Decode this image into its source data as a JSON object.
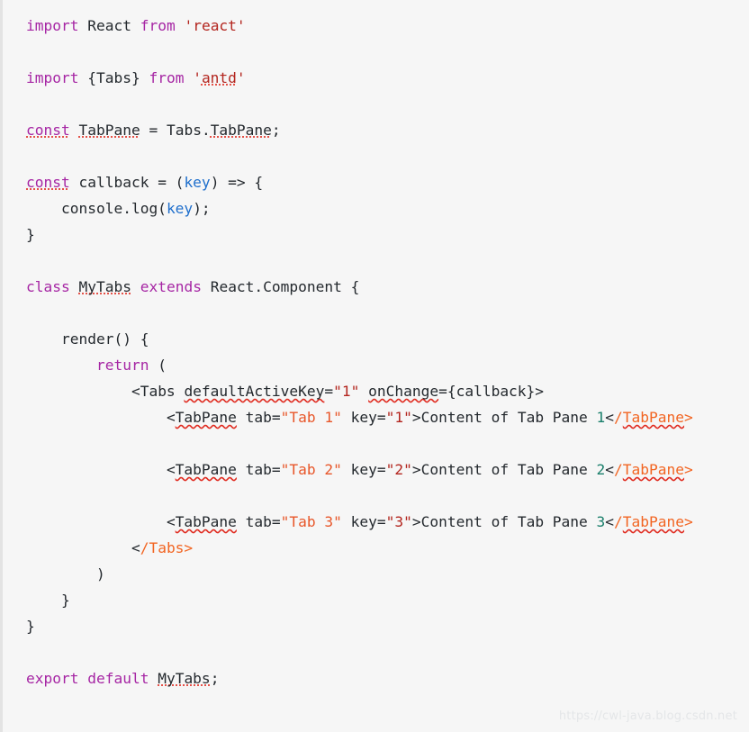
{
  "editor": {
    "background_color": "#f6f6f6",
    "gutter_border_color": "#e3e3e3",
    "default_text_color": "#24292e",
    "language": "jsx",
    "colors": {
      "keyword": "#a626a4",
      "string": "#b3251e",
      "string_attr": "#e8572a",
      "parameter": "#1f6fcc",
      "closing_tag": "#f26522",
      "number": "#1a7f6b",
      "error_underline": "#e02b20"
    }
  },
  "code": {
    "lines": [
      {
        "id": "line-import-react",
        "tokens": [
          {
            "t": "import",
            "c": "tok-kw"
          },
          {
            "t": " React ",
            "c": "tok-plain"
          },
          {
            "t": "from",
            "c": "tok-kw"
          },
          {
            "t": " ",
            "c": "tok-plain"
          },
          {
            "t": "'react'",
            "c": "tok-str"
          }
        ]
      },
      {
        "id": "line-blank-1",
        "blank": true,
        "tokens": []
      },
      {
        "id": "line-import-antd",
        "tokens": [
          {
            "t": "import",
            "c": "tok-kw"
          },
          {
            "t": " {Tabs} ",
            "c": "tok-plain"
          },
          {
            "t": "from",
            "c": "tok-kw"
          },
          {
            "t": " ",
            "c": "tok-plain"
          },
          {
            "t": "'",
            "c": "tok-str"
          },
          {
            "t": "antd",
            "c": "tok-str",
            "u": "dot"
          },
          {
            "t": "'",
            "c": "tok-str"
          }
        ]
      },
      {
        "id": "line-blank-2",
        "blank": true,
        "tokens": []
      },
      {
        "id": "line-const-tabpane",
        "tokens": [
          {
            "t": "const",
            "c": "tok-kw",
            "u": "dot"
          },
          {
            "t": " ",
            "c": "tok-plain"
          },
          {
            "t": "TabPane",
            "c": "tok-plain",
            "u": "dot"
          },
          {
            "t": " = Tabs.",
            "c": "tok-plain"
          },
          {
            "t": "TabPane",
            "c": "tok-plain",
            "u": "dot"
          },
          {
            "t": ";",
            "c": "tok-plain"
          }
        ]
      },
      {
        "id": "line-blank-3",
        "blank": true,
        "tokens": []
      },
      {
        "id": "line-const-callback",
        "tokens": [
          {
            "t": "const",
            "c": "tok-kw",
            "u": "dot"
          },
          {
            "t": " callback = (",
            "c": "tok-plain"
          },
          {
            "t": "key",
            "c": "tok-param"
          },
          {
            "t": ") => {",
            "c": "tok-plain"
          }
        ]
      },
      {
        "id": "line-console-log",
        "tokens": [
          {
            "t": "    console.log(",
            "c": "tok-plain"
          },
          {
            "t": "key",
            "c": "tok-param"
          },
          {
            "t": ");",
            "c": "tok-plain"
          }
        ]
      },
      {
        "id": "line-close-callback",
        "tokens": [
          {
            "t": "}",
            "c": "tok-plain"
          }
        ]
      },
      {
        "id": "line-blank-4",
        "blank": true,
        "tokens": []
      },
      {
        "id": "line-class-mytabs",
        "tokens": [
          {
            "t": "class",
            "c": "tok-kw"
          },
          {
            "t": " ",
            "c": "tok-plain"
          },
          {
            "t": "MyTabs",
            "c": "tok-plain",
            "u": "dot"
          },
          {
            "t": " ",
            "c": "tok-plain"
          },
          {
            "t": "extends",
            "c": "tok-kw"
          },
          {
            "t": " React.Component {",
            "c": "tok-plain"
          }
        ]
      },
      {
        "id": "line-blank-5",
        "blank": true,
        "tokens": []
      },
      {
        "id": "line-render",
        "tokens": [
          {
            "t": "    render() {",
            "c": "tok-plain"
          }
        ]
      },
      {
        "id": "line-return",
        "tokens": [
          {
            "t": "        ",
            "c": "tok-plain"
          },
          {
            "t": "return",
            "c": "tok-kw"
          },
          {
            "t": " (",
            "c": "tok-plain"
          }
        ]
      },
      {
        "id": "line-tabs-open",
        "tokens": [
          {
            "t": "            <Tabs ",
            "c": "tok-plain"
          },
          {
            "t": "defaultActiveKey",
            "c": "tok-plain",
            "u": "wavy"
          },
          {
            "t": "=",
            "c": "tok-plain"
          },
          {
            "t": "\"1\"",
            "c": "tok-str"
          },
          {
            "t": " ",
            "c": "tok-plain"
          },
          {
            "t": "onChange",
            "c": "tok-plain",
            "u": "wavy"
          },
          {
            "t": "={callback}>",
            "c": "tok-plain"
          }
        ]
      },
      {
        "id": "line-tabpane-1",
        "tokens": [
          {
            "t": "                <",
            "c": "tok-plain"
          },
          {
            "t": "TabPane",
            "c": "tok-plain",
            "u": "wavy"
          },
          {
            "t": " tab=",
            "c": "tok-plain"
          },
          {
            "t": "\"Tab 1\"",
            "c": "tok-str2"
          },
          {
            "t": " key=",
            "c": "tok-plain"
          },
          {
            "t": "\"1\"",
            "c": "tok-str"
          },
          {
            "t": ">Content of Tab Pane ",
            "c": "tok-plain"
          },
          {
            "t": "1",
            "c": "tok-num"
          },
          {
            "t": "<",
            "c": "tok-plain"
          },
          {
            "t": "/",
            "c": "tok-tagclose"
          },
          {
            "t": "TabPane",
            "c": "tok-tagclose",
            "u": "wavy"
          },
          {
            "t": ">",
            "c": "tok-tagclose"
          }
        ]
      },
      {
        "id": "line-blank-6",
        "blank": true,
        "tokens": []
      },
      {
        "id": "line-tabpane-2",
        "tokens": [
          {
            "t": "                <",
            "c": "tok-plain"
          },
          {
            "t": "TabPane",
            "c": "tok-plain",
            "u": "wavy"
          },
          {
            "t": " tab=",
            "c": "tok-plain"
          },
          {
            "t": "\"Tab 2\"",
            "c": "tok-str2"
          },
          {
            "t": " key=",
            "c": "tok-plain"
          },
          {
            "t": "\"2\"",
            "c": "tok-str"
          },
          {
            "t": ">Content of Tab Pane ",
            "c": "tok-plain"
          },
          {
            "t": "2",
            "c": "tok-num"
          },
          {
            "t": "<",
            "c": "tok-plain"
          },
          {
            "t": "/",
            "c": "tok-tagclose"
          },
          {
            "t": "TabPane",
            "c": "tok-tagclose",
            "u": "wavy"
          },
          {
            "t": ">",
            "c": "tok-tagclose"
          }
        ]
      },
      {
        "id": "line-blank-7",
        "blank": true,
        "tokens": []
      },
      {
        "id": "line-tabpane-3",
        "tokens": [
          {
            "t": "                <",
            "c": "tok-plain"
          },
          {
            "t": "TabPane",
            "c": "tok-plain",
            "u": "wavy"
          },
          {
            "t": " tab=",
            "c": "tok-plain"
          },
          {
            "t": "\"Tab 3\"",
            "c": "tok-str2"
          },
          {
            "t": " key=",
            "c": "tok-plain"
          },
          {
            "t": "\"3\"",
            "c": "tok-str"
          },
          {
            "t": ">Content of Tab Pane ",
            "c": "tok-plain"
          },
          {
            "t": "3",
            "c": "tok-num"
          },
          {
            "t": "<",
            "c": "tok-plain"
          },
          {
            "t": "/",
            "c": "tok-tagclose"
          },
          {
            "t": "TabPane",
            "c": "tok-tagclose",
            "u": "wavy"
          },
          {
            "t": ">",
            "c": "tok-tagclose"
          }
        ]
      },
      {
        "id": "line-tabs-close",
        "tokens": [
          {
            "t": "            ",
            "c": "tok-plain"
          },
          {
            "t": "<",
            "c": "tok-plain"
          },
          {
            "t": "/Tabs>",
            "c": "tok-tagclose"
          }
        ]
      },
      {
        "id": "line-close-paren",
        "tokens": [
          {
            "t": "        )",
            "c": "tok-plain"
          }
        ]
      },
      {
        "id": "line-close-render",
        "tokens": [
          {
            "t": "    }",
            "c": "tok-plain"
          }
        ]
      },
      {
        "id": "line-close-class",
        "tokens": [
          {
            "t": "}",
            "c": "tok-plain"
          }
        ]
      },
      {
        "id": "line-blank-8",
        "blank": true,
        "tokens": []
      },
      {
        "id": "line-export-default",
        "tokens": [
          {
            "t": "export default",
            "c": "tok-kw"
          },
          {
            "t": " ",
            "c": "tok-plain"
          },
          {
            "t": "MyTabs",
            "c": "tok-plain",
            "u": "dot"
          },
          {
            "t": ";",
            "c": "tok-plain"
          }
        ]
      }
    ]
  },
  "watermark": {
    "text": "https://cwl-java.blog.csdn.net",
    "color": "#e4e6e8"
  }
}
